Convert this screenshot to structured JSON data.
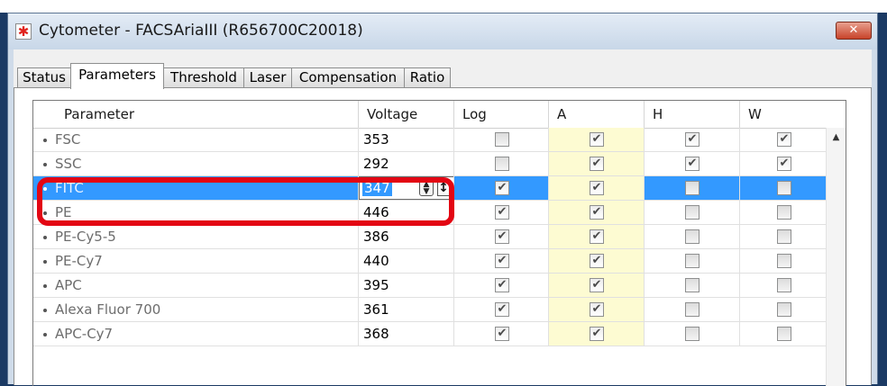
{
  "window": {
    "title": "Cytometer - FACSAriaIII (R656700C20018)",
    "app_icon": "asterisk-icon",
    "close_glyph": "✕"
  },
  "tabs": [
    {
      "label": "Status",
      "active": false
    },
    {
      "label": "Parameters",
      "active": true
    },
    {
      "label": "Threshold",
      "active": false
    },
    {
      "label": "Laser",
      "active": false
    },
    {
      "label": "Compensation",
      "active": false
    },
    {
      "label": "Ratio",
      "active": false
    }
  ],
  "grid": {
    "columns": [
      "Parameter",
      "Voltage",
      "Log",
      "A",
      "H",
      "W"
    ],
    "rows": [
      {
        "parameter": "FSC",
        "voltage": "353",
        "log": false,
        "a": true,
        "h": true,
        "w": true
      },
      {
        "parameter": "SSC",
        "voltage": "292",
        "log": false,
        "a": true,
        "h": true,
        "w": true
      },
      {
        "parameter": "FITC",
        "voltage": "347",
        "log": true,
        "a": true,
        "h": false,
        "w": false,
        "selected": true,
        "editing": true
      },
      {
        "parameter": "PE",
        "voltage": "446",
        "log": true,
        "a": true,
        "h": false,
        "w": false
      },
      {
        "parameter": "PE-Cy5-5",
        "voltage": "386",
        "log": true,
        "a": true,
        "h": false,
        "w": false
      },
      {
        "parameter": "PE-Cy7",
        "voltage": "440",
        "log": true,
        "a": true,
        "h": false,
        "w": false
      },
      {
        "parameter": "APC",
        "voltage": "395",
        "log": true,
        "a": true,
        "h": false,
        "w": false
      },
      {
        "parameter": "Alexa Fluor 700",
        "voltage": "361",
        "log": true,
        "a": true,
        "h": false,
        "w": false
      },
      {
        "parameter": "APC-Cy7",
        "voltage": "368",
        "log": true,
        "a": true,
        "h": false,
        "w": false
      }
    ]
  },
  "colors": {
    "selection": "#3399ff",
    "a_column": "#fdfbd2",
    "highlight": "#e30613"
  }
}
